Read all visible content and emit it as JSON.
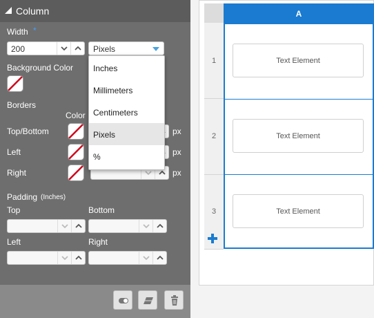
{
  "panel": {
    "title": "Column",
    "width_label": "Width",
    "width_required_mark": "*",
    "width_value": "200",
    "unit_selected": "Pixels",
    "unit_options": [
      "Inches",
      "Millimeters",
      "Centimeters",
      "Pixels",
      "%"
    ],
    "background_color_label": "Background Color",
    "borders_label": "Borders",
    "color_col_label": "Color",
    "border_rows": [
      {
        "label": "Top/Bottom",
        "unit": "px"
      },
      {
        "label": "Left",
        "unit": "px"
      },
      {
        "label": "Right",
        "unit": "px"
      }
    ],
    "padding_label": "Padding",
    "padding_unit": "(Inches)",
    "padding_top_label": "Top",
    "padding_bottom_label": "Bottom",
    "padding_left_label": "Left",
    "padding_right_label": "Right"
  },
  "grid": {
    "column_header": "A",
    "rows": [
      {
        "number": "1",
        "element": "Text Element"
      },
      {
        "number": "2",
        "element": "Text Element"
      },
      {
        "number": "3",
        "element": "Text Element"
      }
    ]
  },
  "colors": {
    "accent": "#1a7bd0",
    "panel_bg": "#6e6e6e",
    "required_mark": "#3fa0ff"
  }
}
